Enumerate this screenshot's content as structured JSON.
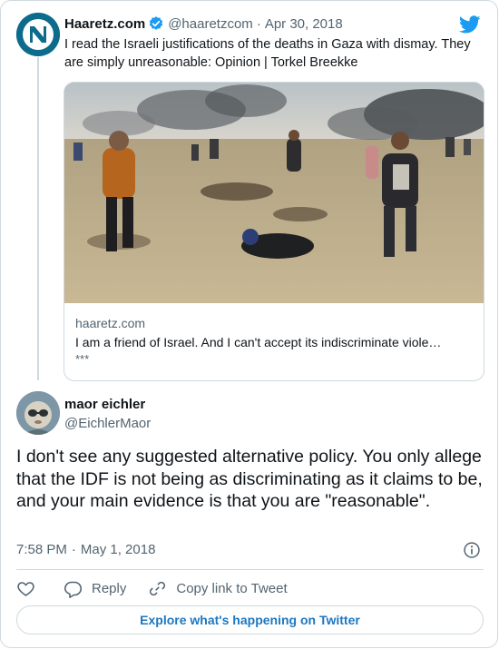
{
  "parent_tweet": {
    "author_name": "Haaretz.com",
    "author_handle": "@haaretzcom",
    "separator": "·",
    "date": "Apr 30, 2018",
    "text": "I read the Israeli justifications of the deaths in Gaza with dismay. They are simply unreasonable: Opinion | Torkel Breekke",
    "verified_icon": "verified-badge-icon",
    "brand_icon": "twitter-bird-icon"
  },
  "link_card": {
    "domain": "haaretz.com",
    "title": "I am a friend of Israel. And I can't accept its indiscriminate viole…",
    "description": "***"
  },
  "reply_tweet": {
    "author_name": "maor eichler",
    "author_handle": "@EichlerMaor",
    "text": "I don't see any suggested alternative policy. You only allege that the IDF is not being as discriminating as it claims to be, and your main evidence is that you are \"reasonable\".",
    "time": "7:58 PM",
    "separator": "·",
    "date": "May 1, 2018"
  },
  "actions": {
    "reply_label": "Reply",
    "copy_link_label": "Copy link to Tweet"
  },
  "explore_label": "Explore what's happening on Twitter",
  "colors": {
    "twitter_blue": "#1d9bf0",
    "link_blue": "#1d77c0",
    "muted_text": "#536471",
    "border": "#cfd9de",
    "haaretz_brand": "#0d6b8c"
  }
}
